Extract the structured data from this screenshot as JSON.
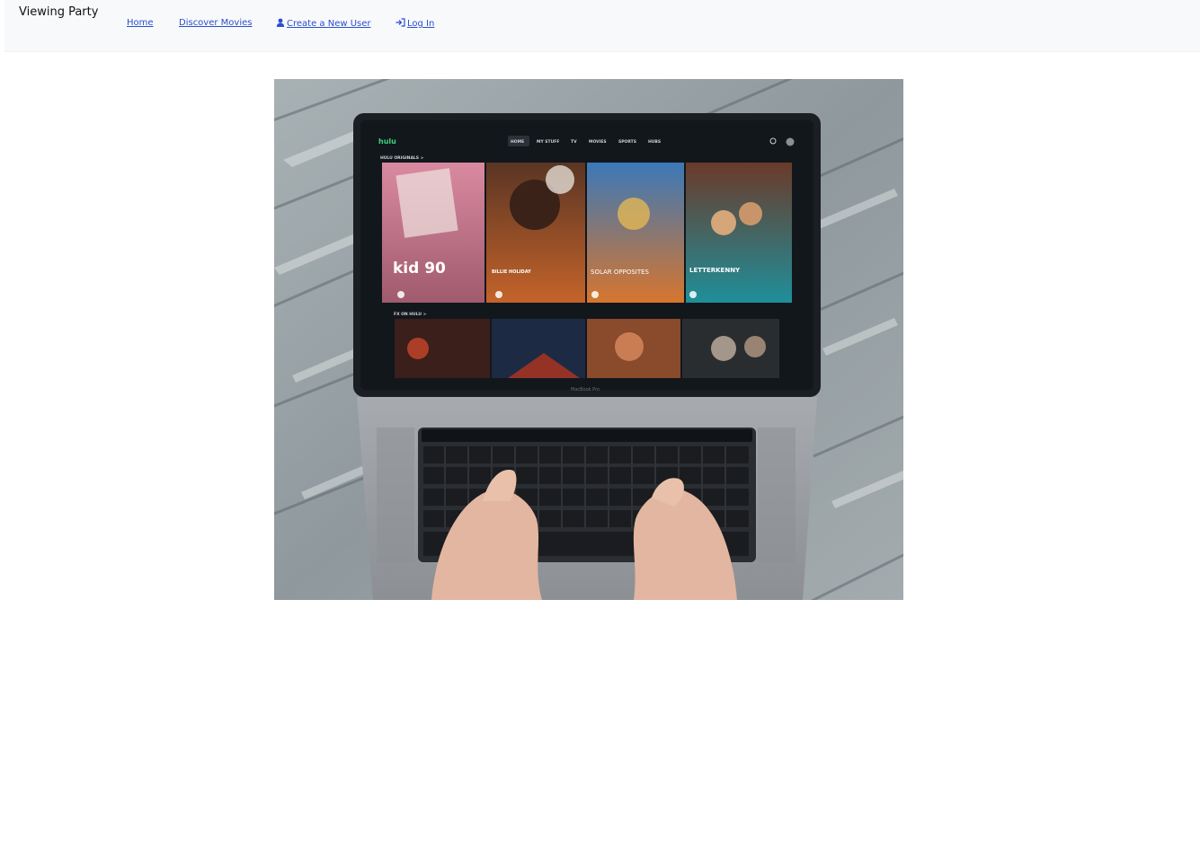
{
  "nav": {
    "brand": "Viewing Party",
    "home": "Home",
    "discover": "Discover Movies",
    "create_user": "Create a New User",
    "login": "Log In"
  },
  "hero": {
    "screen_brand": "hulu",
    "screen_tabs": [
      "HOME",
      "MY STUFF",
      "TV",
      "MOVIES",
      "SPORTS",
      "HUBS"
    ],
    "row1_title": "HULU ORIGINALS >",
    "row2_title": "FX ON HULU >",
    "tiles": [
      "kid 90",
      "BILLIE HOLIDAY",
      "SOLAR OPPOSITES",
      "LETTERKENNY"
    ],
    "laptop_label": "MacBook Pro",
    "colors": {
      "wood": "#9aa3a6",
      "screen_bg": "#12171c",
      "laptop": "#9a9ea2",
      "link": "#2a4fd0"
    }
  }
}
